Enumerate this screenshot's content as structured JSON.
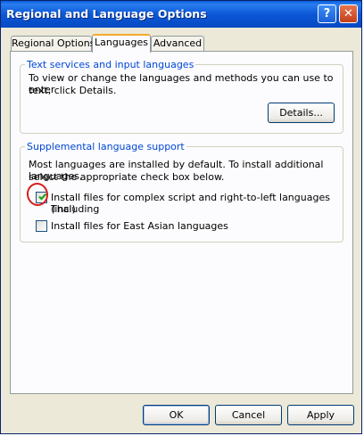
{
  "window": {
    "title": "Regional and Language Options",
    "help_glyph": "?",
    "close_glyph": "✕"
  },
  "tabs": [
    {
      "label": "Regional Options",
      "active": false
    },
    {
      "label": "Languages",
      "active": true
    },
    {
      "label": "Advanced",
      "active": false
    }
  ],
  "text_services": {
    "legend": "Text services and input languages",
    "line1": "To view or change the languages and methods you can use to enter",
    "line2": "text, click Details.",
    "details_button": "Details..."
  },
  "supplemental": {
    "legend": "Supplemental language support",
    "line1": "Most languages are installed by default. To install additional languages,",
    "line2": "select the appropriate check box below.",
    "complex_line1": "Install files for complex script and right-to-left languages (including",
    "complex_line2": "Thai)",
    "complex_checked": true,
    "east_asian": "Install files for East Asian languages",
    "east_asian_checked": false
  },
  "buttons": {
    "ok": "OK",
    "cancel": "Cancel",
    "apply": "Apply"
  },
  "colors": {
    "title_bar": "#0b58d7",
    "group_legend": "#0046d5",
    "annotation": "#d81e1e"
  }
}
